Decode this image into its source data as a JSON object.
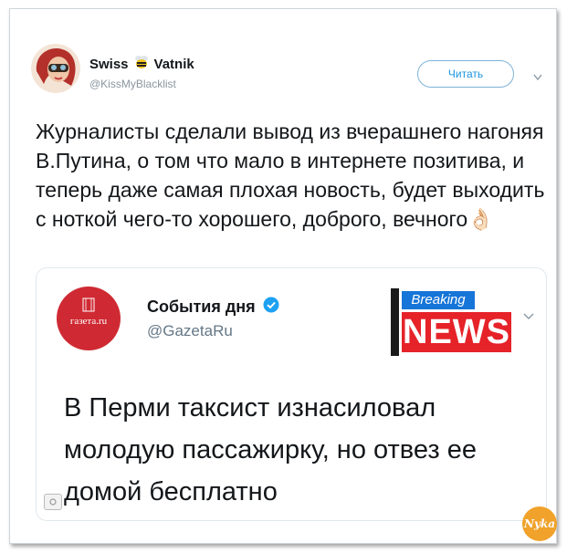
{
  "tweet": {
    "author_name_part1": "Swiss",
    "author_name_part2": "Vatnik",
    "author_handle": "@KissMyBlacklist",
    "follow_label": "Читать",
    "text": "Журналисты сделали вывод из вчерашнего нагоняя В.Путина, о том что мало в интернете позитива, и теперь даже самая плохая новость, будет выходить с ноткой чего-то хорошего, доброго, вечного👌🏻"
  },
  "quoted": {
    "avatar_text": "газета.ru",
    "name": "События дня",
    "handle": "@GazetaRu",
    "badge_top": "Breaking",
    "badge_main": "NEWS",
    "text": "В Перми таксист изнасиловал молодую пассажирку, но отвез ее домой бесплатно"
  },
  "watermark": "Nyka",
  "icons": [
    "bee-icon",
    "verified-icon",
    "chevron-down-icon",
    "media-icon"
  ],
  "colors": {
    "accent": "#1b95e0",
    "gazeta_red": "#cf2a33",
    "news_red": "#e52329",
    "breaking_blue": "#1675d8"
  }
}
